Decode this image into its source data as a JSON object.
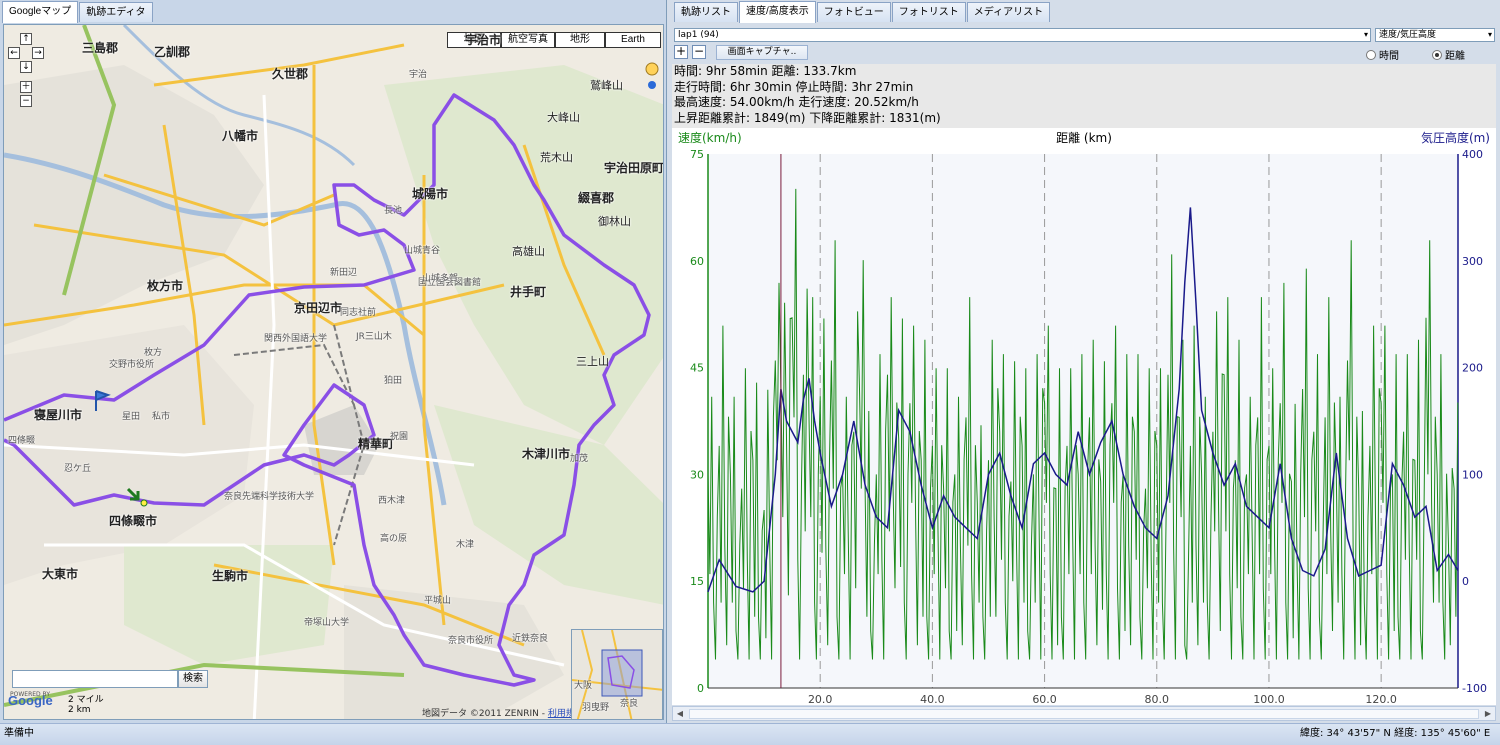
{
  "left_tabs": [
    "Googleマップ",
    "軌跡エディタ"
  ],
  "right_tabs": [
    "軌跡リスト",
    "速度/高度表示",
    "フォトビュー",
    "フォトリスト",
    "メディアリスト"
  ],
  "map": {
    "types": [
      "地図",
      "航空写真",
      "地形",
      "Earth"
    ],
    "selected_type": "地図",
    "nav_buttons": [
      "←",
      "→",
      "↑",
      "↓",
      "＋",
      "−"
    ],
    "labels": [
      {
        "text": "三島郡",
        "big": true
      },
      {
        "text": "乙訓郡",
        "big": true
      },
      {
        "text": "久世郡",
        "big": true
      },
      {
        "text": "八幡市",
        "big": true
      },
      {
        "text": "城陽市",
        "big": true
      },
      {
        "text": "宇治田原町",
        "big": true
      },
      {
        "text": "綴喜郡",
        "big": true
      },
      {
        "text": "枚方市",
        "big": true
      },
      {
        "text": "京田辺市",
        "big": true
      },
      {
        "text": "井手町",
        "big": true
      },
      {
        "text": "寝屋川市",
        "big": true
      },
      {
        "text": "精華町",
        "big": true
      },
      {
        "text": "木津川市",
        "big": true
      },
      {
        "text": "四條畷市",
        "big": true
      },
      {
        "text": "大東市",
        "big": true
      },
      {
        "text": "生駒市",
        "big": true
      },
      {
        "text": "宇治市",
        "big": true
      },
      {
        "text": "鷲峰山",
        "big": false
      },
      {
        "text": "御林山",
        "big": false
      },
      {
        "text": "大峰山",
        "big": false
      },
      {
        "text": "高雄山",
        "big": false
      },
      {
        "text": "三上山",
        "big": false
      },
      {
        "text": "荒木山",
        "big": false
      },
      {
        "text": "交野市役所",
        "big": false
      },
      {
        "text": "奈良先端科学技術大学",
        "big": false
      },
      {
        "text": "国立国会図書館",
        "big": false
      },
      {
        "text": "関西外国語大学",
        "big": false
      },
      {
        "text": "同志社前",
        "big": false
      },
      {
        "text": "山城青谷",
        "big": false
      },
      {
        "text": "山城多賀",
        "big": false
      },
      {
        "text": "木津",
        "big": false
      },
      {
        "text": "加茂",
        "big": false
      },
      {
        "text": "平城山",
        "big": false
      },
      {
        "text": "高の原",
        "big": false
      },
      {
        "text": "奈良市役所",
        "big": false
      },
      {
        "text": "帝塚山大学",
        "big": false
      },
      {
        "text": "四條畷",
        "big": false
      },
      {
        "text": "忍ケ丘",
        "big": false
      },
      {
        "text": "長池",
        "big": false
      },
      {
        "text": "祝園",
        "big": false
      },
      {
        "text": "西木津",
        "big": false
      },
      {
        "text": "狛田",
        "big": false
      },
      {
        "text": "枚方",
        "big": false
      },
      {
        "text": "星田",
        "big": false
      },
      {
        "text": "私市",
        "big": false
      },
      {
        "text": "新田辺",
        "big": false
      },
      {
        "text": "JR三山木",
        "big": false
      },
      {
        "text": "宇治",
        "big": false
      },
      {
        "text": "近鉄奈良",
        "big": false
      }
    ],
    "search_button": "検索",
    "search_value": "",
    "scale_mi": "2 マイル",
    "scale_km": "2 km",
    "logo": "Google",
    "powered": "POWERED BY",
    "copyright": "地図データ ©2011 ZENRIN - ",
    "terms_link": "利用規約",
    "overview_labels": [
      "大阪",
      "奈良",
      "羽曳野"
    ]
  },
  "lap": {
    "select_value": "lap1 (94)",
    "graph_select_value": "速度/気圧高度",
    "add": "+",
    "remove": "−",
    "capture_button": "画面キャプチャ..",
    "radio_time": "時間",
    "radio_distance": "距離",
    "radio_selected": "距離"
  },
  "stats": [
    "時間: 9hr 58min  距離: 133.7km",
    "走行時間: 6hr 30min  停止時間: 3hr 27min",
    "最高速度: 54.00km/h  走行速度: 20.52km/h",
    "上昇距離累計: 1849(m)  下降距離累計: 1831(m)"
  ],
  "chart_data": {
    "type": "line",
    "xlabel": "距離 (km)",
    "ylabel_left": "速度(km/h)",
    "ylabel_right": "気圧高度(m)",
    "x_range": [
      0,
      133.7
    ],
    "x_ticks": [
      20,
      40,
      60,
      80,
      100,
      120
    ],
    "x_tick_labels": [
      "20.0",
      "40.0",
      "60.0",
      "80.0",
      "100.0",
      "120.0"
    ],
    "y_left_range": [
      0,
      75
    ],
    "y_left_ticks": [
      0,
      15,
      30,
      45,
      60,
      75
    ],
    "y_right_range": [
      -100,
      400
    ],
    "y_right_ticks": [
      -100,
      0,
      100,
      200,
      300,
      400
    ],
    "marker_x": 13,
    "colors": {
      "speed": "#1a8a1a",
      "altitude": "#1a1a8a",
      "marker": "#7a1a3a",
      "left_axis_text": "#1a8a1a",
      "right_axis_text": "#1a1a8a"
    },
    "series": [
      {
        "name": "気圧高度",
        "axis": "right",
        "x": [
          0,
          2,
          5,
          8,
          10,
          12,
          13,
          14,
          16,
          17,
          18,
          19,
          20,
          22,
          24,
          26,
          28,
          30,
          32,
          34,
          36,
          38,
          40,
          42,
          44,
          46,
          48,
          50,
          52,
          54,
          56,
          58,
          60,
          62,
          64,
          66,
          68,
          70,
          72,
          74,
          76,
          78,
          80,
          82,
          84,
          85,
          86,
          87,
          88,
          90,
          92,
          94,
          96,
          98,
          100,
          102,
          104,
          106,
          108,
          110,
          112,
          114,
          116,
          118,
          120,
          122,
          124,
          126,
          128,
          130,
          132,
          133.7
        ],
        "values": [
          -10,
          20,
          -5,
          -10,
          0,
          100,
          180,
          150,
          130,
          170,
          190,
          150,
          120,
          70,
          100,
          150,
          90,
          60,
          50,
          160,
          140,
          90,
          50,
          80,
          60,
          50,
          40,
          100,
          120,
          80,
          50,
          110,
          120,
          100,
          90,
          140,
          100,
          130,
          150,
          100,
          70,
          50,
          40,
          80,
          180,
          280,
          350,
          260,
          160,
          120,
          90,
          110,
          70,
          60,
          50,
          110,
          40,
          10,
          5,
          30,
          120,
          40,
          5,
          10,
          15,
          110,
          90,
          60,
          70,
          10,
          25,
          10
        ]
      },
      {
        "name": "速度",
        "axis": "left",
        "x": [
          0,
          1,
          2,
          3,
          4,
          5,
          6,
          7,
          8,
          9,
          10,
          11,
          12,
          13,
          14,
          15,
          16,
          17,
          18,
          19,
          20,
          21,
          22,
          23,
          24,
          25,
          26,
          27,
          28,
          29,
          30,
          31,
          32,
          33,
          34,
          35,
          36,
          37,
          38,
          39,
          40,
          41,
          42,
          43,
          44,
          45,
          46,
          47,
          48,
          49,
          50,
          51,
          52,
          53,
          54,
          55,
          56,
          57,
          58,
          59,
          60,
          61,
          62,
          63,
          64,
          65,
          66,
          67,
          68,
          69,
          70,
          71,
          72,
          73,
          74,
          75,
          76,
          77,
          78,
          79,
          80,
          81,
          82,
          83,
          84,
          85,
          86,
          87,
          88,
          89,
          90,
          91,
          92,
          93,
          94,
          95,
          96,
          97,
          98,
          99,
          100,
          101,
          102,
          103,
          104,
          105,
          106,
          107,
          108,
          109,
          110,
          111,
          112,
          113,
          114,
          115,
          116,
          117,
          118,
          119,
          120,
          121,
          122,
          123,
          124,
          125,
          126,
          127,
          128,
          129,
          130,
          131,
          132,
          133
        ],
        "values": [
          30,
          12,
          34,
          20,
          30,
          8,
          28,
          18,
          32,
          10,
          25,
          20,
          46,
          42,
          35,
          52,
          18,
          44,
          38,
          12,
          41,
          20,
          46,
          10,
          30,
          22,
          36,
          42,
          28,
          8,
          30,
          18,
          44,
          28,
          35,
          12,
          40,
          24,
          32,
          10,
          34,
          22,
          28,
          8,
          30,
          20,
          38,
          16,
          26,
          10,
          32,
          24,
          36,
          12,
          29,
          20,
          34,
          8,
          30,
          24,
          40,
          16,
          28,
          10,
          34,
          22,
          30,
          12,
          38,
          20,
          29,
          16,
          40,
          14,
          30,
          20,
          36,
          10,
          28,
          18,
          34,
          12,
          44,
          20,
          38,
          6,
          34,
          20,
          30,
          12,
          36,
          26,
          44,
          16,
          32,
          10,
          30,
          22,
          38,
          14,
          34,
          20,
          40,
          12,
          29,
          18,
          42,
          14,
          36,
          10,
          38,
          22,
          30,
          16,
          46,
          20,
          28,
          12,
          34,
          24,
          40,
          16,
          30,
          10,
          36,
          20,
          32,
          8,
          52,
          26,
          30,
          12,
          20,
          28
        ]
      }
    ]
  },
  "status": {
    "left": "準備中",
    "right": "緯度: 34° 43'57\" N  経度: 135° 45'60\" E"
  }
}
